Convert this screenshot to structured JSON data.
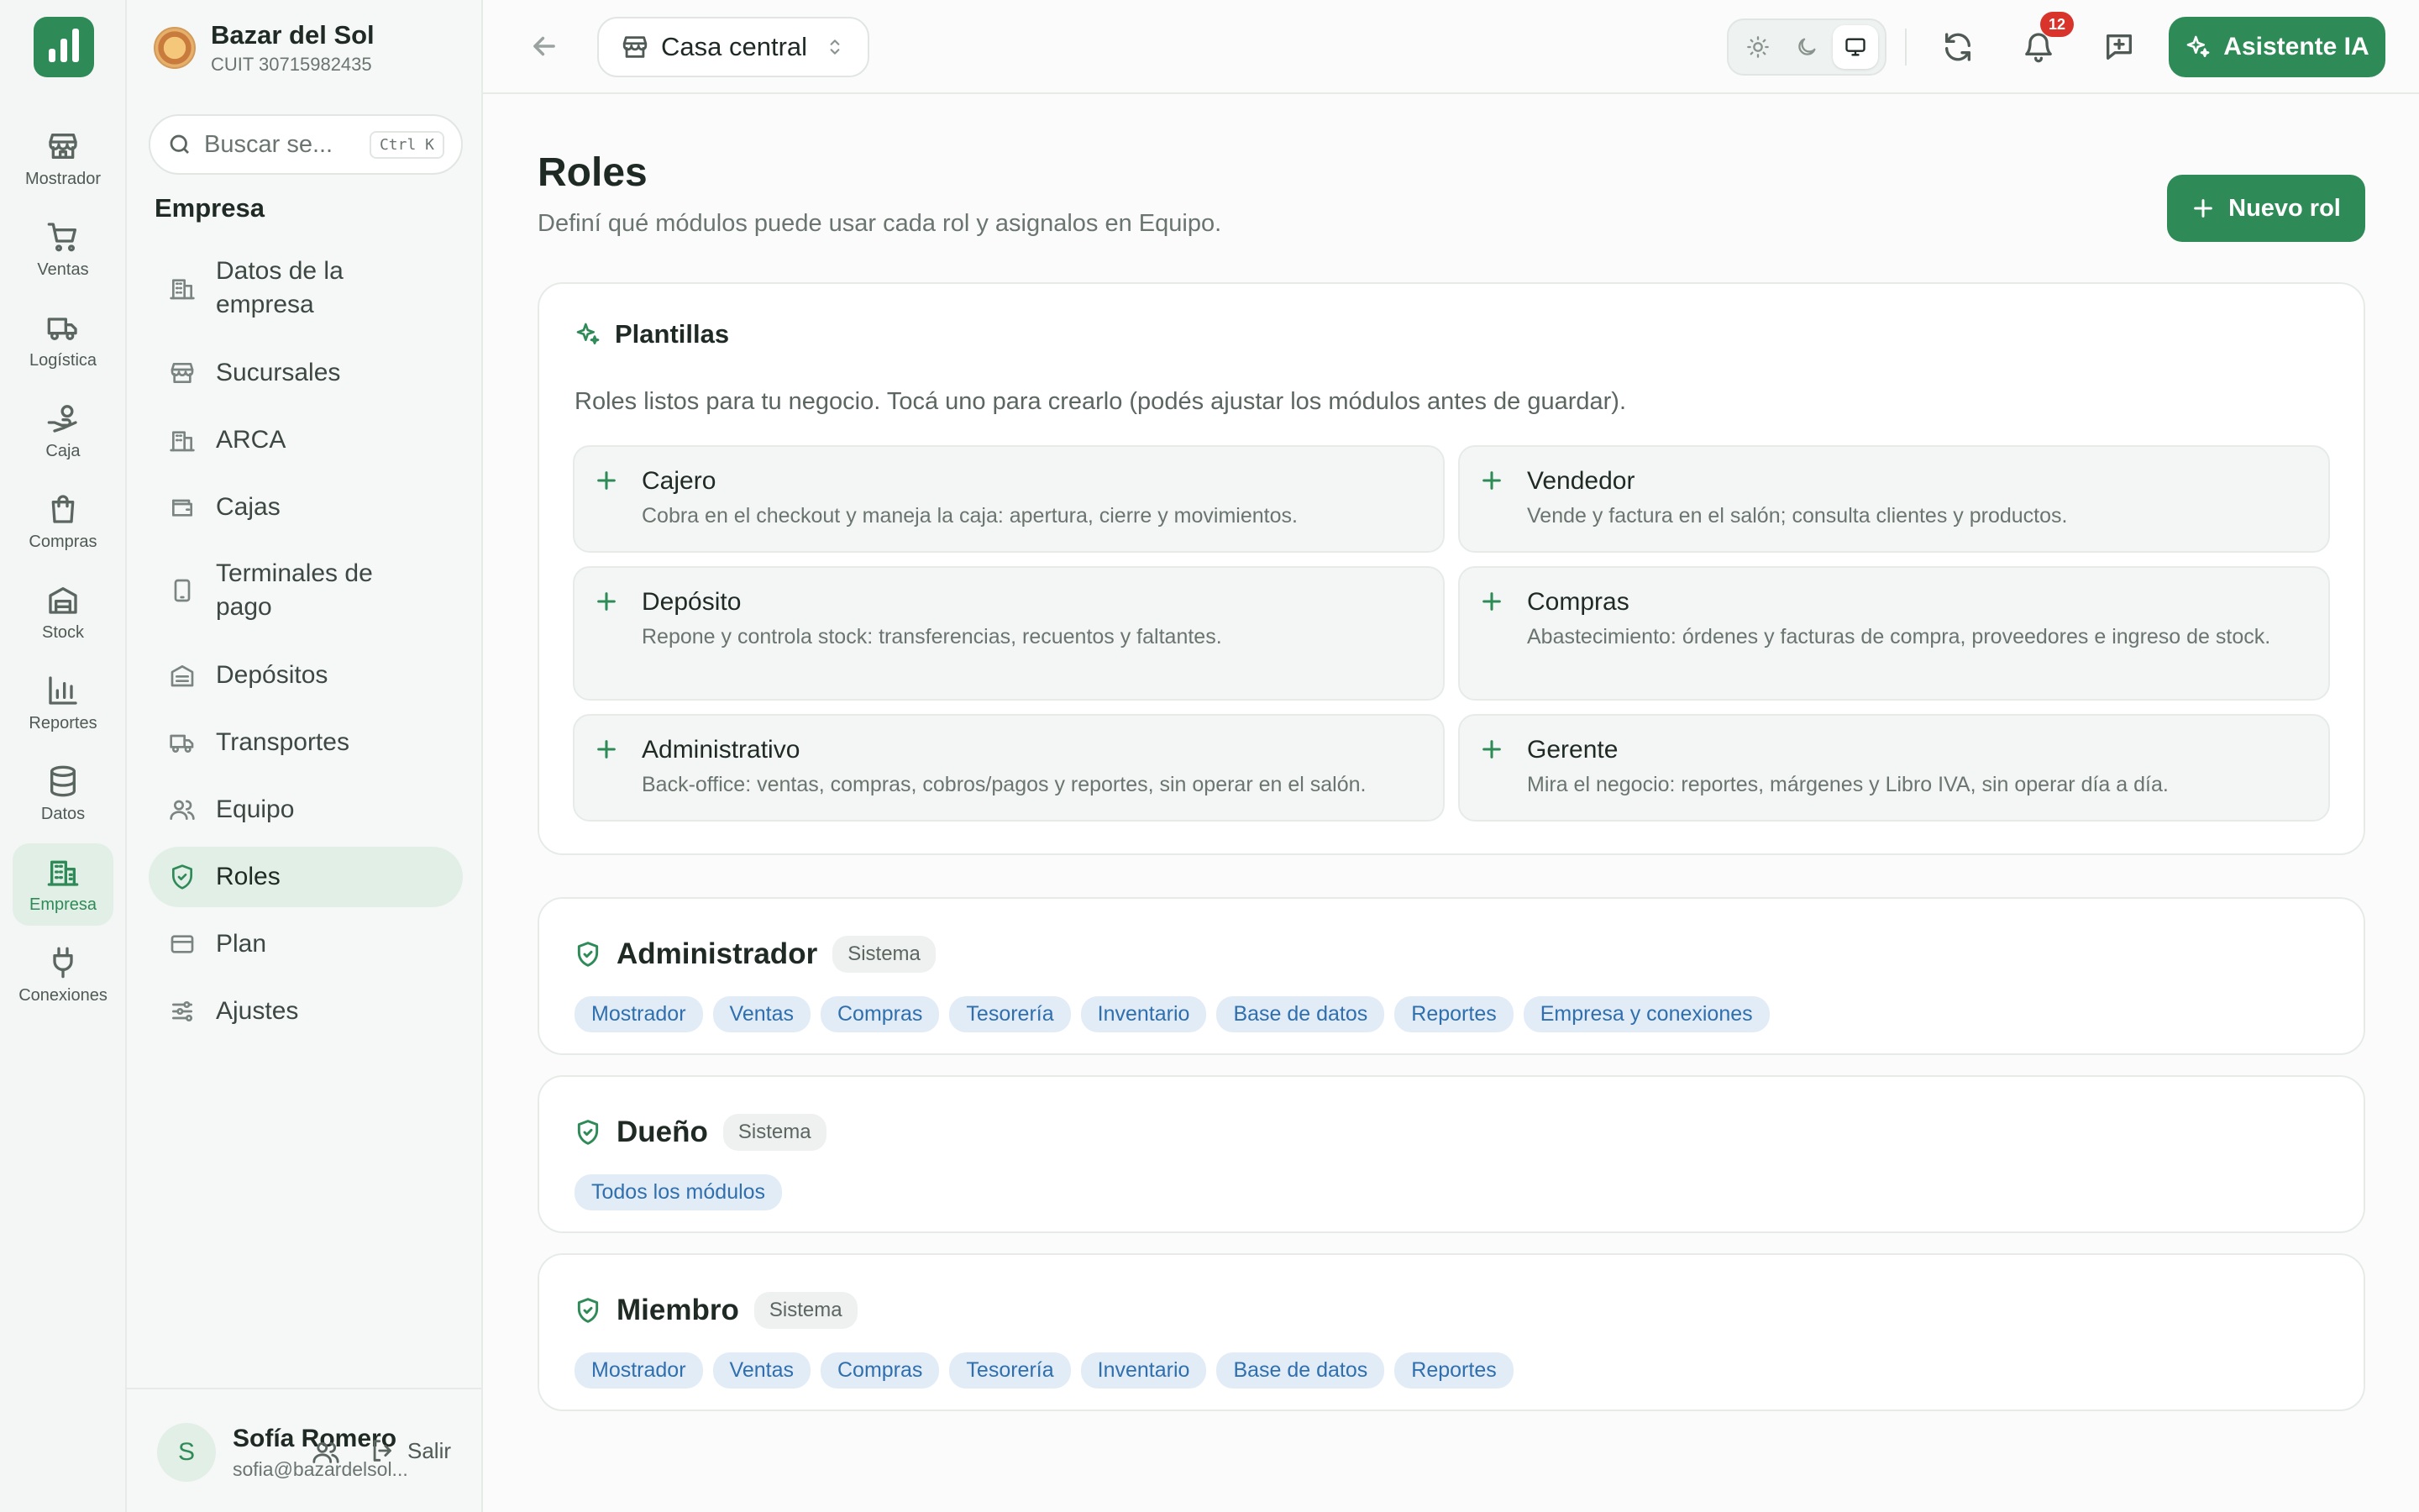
{
  "rail": [
    {
      "label": "Mostrador",
      "icon": "store-icon"
    },
    {
      "label": "Ventas",
      "icon": "cart-icon"
    },
    {
      "label": "Logística",
      "icon": "truck-icon"
    },
    {
      "label": "Caja",
      "icon": "hand-coins-icon"
    },
    {
      "label": "Compras",
      "icon": "bag-icon"
    },
    {
      "label": "Stock",
      "icon": "warehouse-icon"
    },
    {
      "label": "Reportes",
      "icon": "bar-chart-icon"
    },
    {
      "label": "Datos",
      "icon": "database-icon"
    },
    {
      "label": "Empresa",
      "icon": "building-icon",
      "active": true
    },
    {
      "label": "Conexiones",
      "icon": "plug-icon"
    }
  ],
  "brand": {
    "name": "Bazar del Sol",
    "cuit": "CUIT 30715982435"
  },
  "search": {
    "placeholder": "Buscar se...",
    "shortcut": "Ctrl K"
  },
  "sidebar": {
    "section": "Empresa",
    "items": [
      {
        "label": "Datos de la empresa",
        "icon": "building-icon"
      },
      {
        "label": "Sucursales",
        "icon": "store-icon"
      },
      {
        "label": "ARCA",
        "icon": "building-icon"
      },
      {
        "label": "Cajas",
        "icon": "wallet-icon"
      },
      {
        "label": "Terminales de pago",
        "icon": "tablet-icon"
      },
      {
        "label": "Depósitos",
        "icon": "warehouse-icon"
      },
      {
        "label": "Transportes",
        "icon": "truck-icon"
      },
      {
        "label": "Equipo",
        "icon": "users-icon"
      },
      {
        "label": "Roles",
        "icon": "shield-icon",
        "active": true
      },
      {
        "label": "Plan",
        "icon": "credit-card-icon"
      },
      {
        "label": "Ajustes",
        "icon": "sliders-icon"
      }
    ]
  },
  "user": {
    "initial": "S",
    "name": "Sofía Romero",
    "email": "sofia@bazardelsol...",
    "logout": "Salir"
  },
  "topbar": {
    "branch": "Casa central",
    "notifications": "12",
    "ai_label": "Asistente IA"
  },
  "page": {
    "title": "Roles",
    "subtitle": "Definí qué módulos puede usar cada rol y asignalos en Equipo.",
    "new_role": "Nuevo rol"
  },
  "templates": {
    "title": "Plantillas",
    "description": "Roles listos para tu negocio. Tocá uno para crearlo (podés ajustar los módulos antes de guardar).",
    "items": [
      {
        "name": "Cajero",
        "desc": "Cobra en el checkout y maneja la caja: apertura, cierre y movimientos."
      },
      {
        "name": "Vendedor",
        "desc": "Vende y factura en el salón; consulta clientes y productos."
      },
      {
        "name": "Depósito",
        "desc": "Repone y controla stock: transferencias, recuentos y faltantes."
      },
      {
        "name": "Compras",
        "desc": "Abastecimiento: órdenes y facturas de compra, proveedores e ingreso de stock."
      },
      {
        "name": "Administrativo",
        "desc": "Back-office: ventas, compras, cobros/pagos y reportes, sin operar en el salón."
      },
      {
        "name": "Gerente",
        "desc": "Mira el negocio: reportes, márgenes y Libro IVA, sin operar día a día."
      }
    ]
  },
  "roles": [
    {
      "name": "Administrador",
      "tag": "Sistema",
      "modules": [
        "Mostrador",
        "Ventas",
        "Compras",
        "Tesorería",
        "Inventario",
        "Base de datos",
        "Reportes",
        "Empresa y conexiones"
      ]
    },
    {
      "name": "Dueño",
      "tag": "Sistema",
      "modules": [
        "Todos los módulos"
      ]
    },
    {
      "name": "Miembro",
      "tag": "Sistema",
      "modules": [
        "Mostrador",
        "Ventas",
        "Compras",
        "Tesorería",
        "Inventario",
        "Base de datos",
        "Reportes"
      ]
    }
  ],
  "colors": {
    "accent": "#2e8b57",
    "chip_text": "#2f6fae",
    "chip_bg": "#e1ecf7",
    "badge": "#d9342b"
  }
}
